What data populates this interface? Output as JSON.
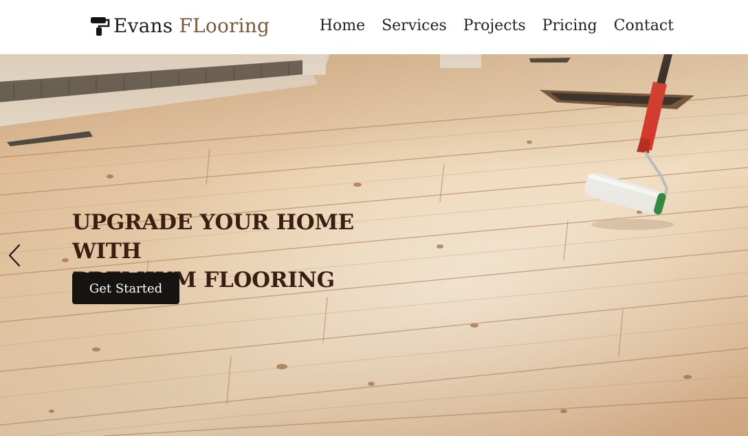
{
  "brand": {
    "name_part1": "Evans ",
    "name_part2": "FLooring",
    "accent_color": "#7a5a3a",
    "icon": "paint-roller-icon"
  },
  "nav": {
    "items": [
      "Home",
      "Services",
      "Projects",
      "Pricing",
      "Contact"
    ]
  },
  "hero": {
    "heading_line1": "UPGRADE YOUR HOME WITH",
    "heading_line2": "PREMIUM FLOORING",
    "cta_label": "Get Started",
    "prev_icon": "chevron-left-icon",
    "background": "wood-floor-photo"
  }
}
